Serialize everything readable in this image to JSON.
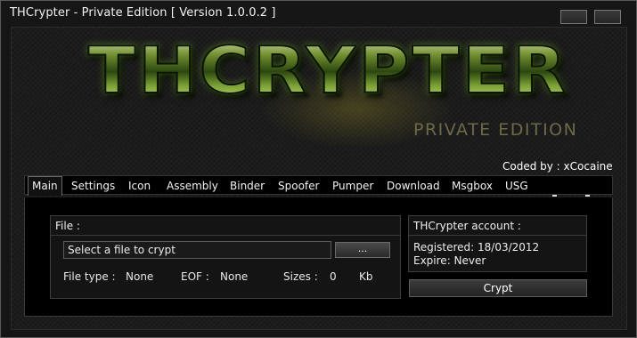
{
  "window": {
    "title": "THCrypter - Private Edition [ Version 1.0.0.2 ]"
  },
  "banner": {
    "logo": "THCRYPTER",
    "subtitle": "PRIVATE EDITION",
    "coded_by": "Coded by : xCocaine"
  },
  "tabs": [
    "Main",
    "Settings",
    "Icon",
    "Assembly",
    "Binder",
    "Spoofer",
    "Pumper",
    "Download",
    "Msgbox",
    "USG"
  ],
  "active_tab": "Main",
  "file_group": {
    "title": "File :",
    "input_value": "Select a file to crypt",
    "browse_label": "...",
    "file_type_label": "File type :",
    "file_type_value": "None",
    "eof_label": "EOF :",
    "eof_value": "None",
    "sizes_label": "Sizes :",
    "sizes_value": "0",
    "sizes_unit": "Kb"
  },
  "account_group": {
    "title": "THCrypter account :",
    "registered": "Registered: 18/03/2012",
    "expire": "Expire: Never"
  },
  "crypt_button": "Crypt",
  "colors": {
    "background": "#151515",
    "accent_green": "#6c8a2d"
  }
}
